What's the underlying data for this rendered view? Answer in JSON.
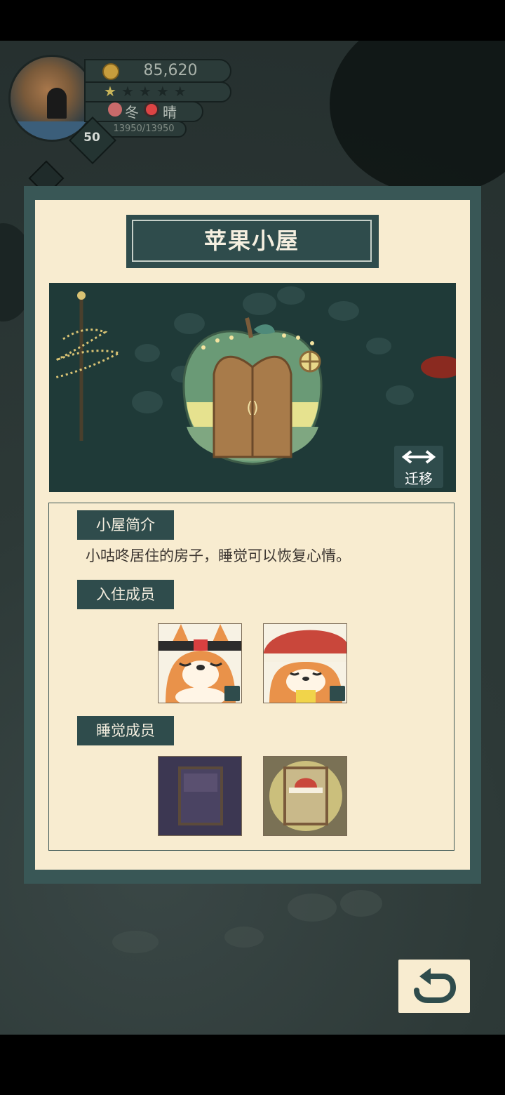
{
  "hud": {
    "coins": "85,620",
    "stars_filled": 1,
    "stars_total": 5,
    "season": "冬",
    "weather": "晴",
    "exp": "13950/13950",
    "level": "50"
  },
  "modal": {
    "title": "苹果小屋",
    "relocate_label": "迁移",
    "intro_header": "小屋简介",
    "description": "小咕咚居住的房子，睡觉可以恢复心情。",
    "residents_header": "入住成员",
    "sleepers_header": "睡觉成员",
    "residents": [
      {
        "name": "shiba-headband",
        "icon": "shiba-headband-avatar"
      },
      {
        "name": "shiba-santa-hat",
        "icon": "shiba-santa-hat-avatar"
      }
    ],
    "sleepers": [
      {
        "state": "empty-bed"
      },
      {
        "state": "occupied-bed"
      }
    ]
  },
  "colors": {
    "panel_dark": "#2f4c4c",
    "panel_light": "#f8ecd0",
    "frame": "#395756"
  }
}
